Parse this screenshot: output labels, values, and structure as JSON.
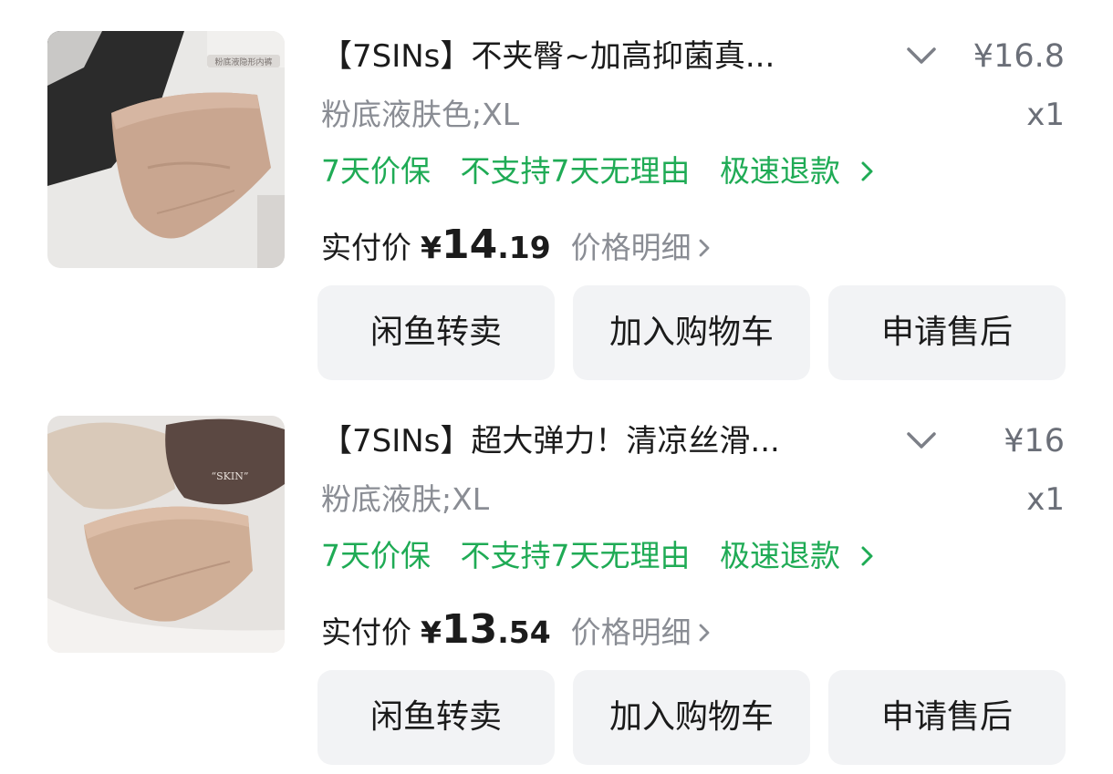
{
  "orders": [
    {
      "title": "【7SINs】不夹臀~加高抑菌真...",
      "original_price": "¥16.8",
      "spec": "粉底液肤色;XL",
      "quantity": "x1",
      "services": [
        "7天价保",
        "不支持7天无理由",
        "极速退款"
      ],
      "paid_label": "实付价",
      "paid_currency": "¥",
      "paid_int": "14",
      "paid_dec": ".19",
      "price_detail": "价格明细",
      "buttons": [
        "闲鱼转卖",
        "加入购物车",
        "申请售后"
      ],
      "thumb_overlay_text": "粉底液隐形内裤"
    },
    {
      "title": "【7SINs】超大弹力！清凉丝滑...",
      "original_price": "¥16",
      "spec": "粉底液肤;XL",
      "quantity": "x1",
      "services": [
        "7天价保",
        "不支持7天无理由",
        "极速退款"
      ],
      "paid_label": "实付价",
      "paid_currency": "¥",
      "paid_int": "13",
      "paid_dec": ".54",
      "price_detail": "价格明细",
      "buttons": [
        "闲鱼转卖",
        "加入购物车",
        "申请售后"
      ],
      "thumb_overlay_text": "“SKIN”"
    }
  ],
  "colors": {
    "service_green": "#1fab55",
    "button_bg": "#f2f3f5",
    "muted_text": "#8a8d94"
  }
}
